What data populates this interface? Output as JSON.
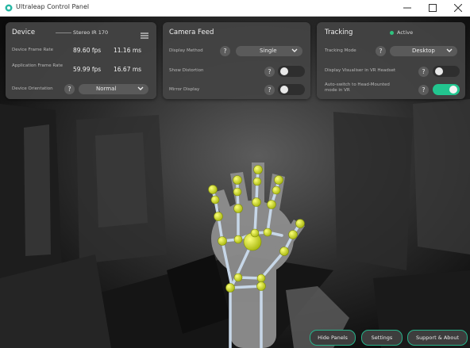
{
  "window": {
    "title": "Ultraleap Control Panel",
    "brand_color": "#27b7a4"
  },
  "device_panel": {
    "title": "Device",
    "device_name": "Stereo IR 170",
    "device_frame_rate_label": "Device Frame Rate",
    "device_fps": "89.60 fps",
    "device_ms": "11.16 ms",
    "application_frame_rate_label": "Application Frame Rate",
    "application_fps": "59.99 fps",
    "application_ms": "16.67 ms",
    "orientation_label": "Device Orientation",
    "orientation_value": "Normal"
  },
  "camera_panel": {
    "title": "Camera Feed",
    "display_method_label": "Display Method",
    "display_method_value": "Single",
    "show_distortion_label": "Show Distortion",
    "show_distortion_on": false,
    "mirror_display_label": "Mirror Display",
    "mirror_display_on": false
  },
  "tracking_panel": {
    "title": "Tracking",
    "status": "Active",
    "status_color": "#2ec27e",
    "mode_label": "Tracking Mode",
    "mode_value": "Desktop",
    "visualiser_label": "Display Visualiser in VR Headset",
    "visualiser_on": false,
    "auto_switch_label": "Auto-switch to Head-Mounted mode in VR",
    "auto_switch_on": true,
    "toggle_on_color": "#22c58f"
  },
  "help_glyph": "?",
  "footer": {
    "hide_panels": "Hide Panels",
    "settings": "Settings",
    "support": "Support & About"
  }
}
